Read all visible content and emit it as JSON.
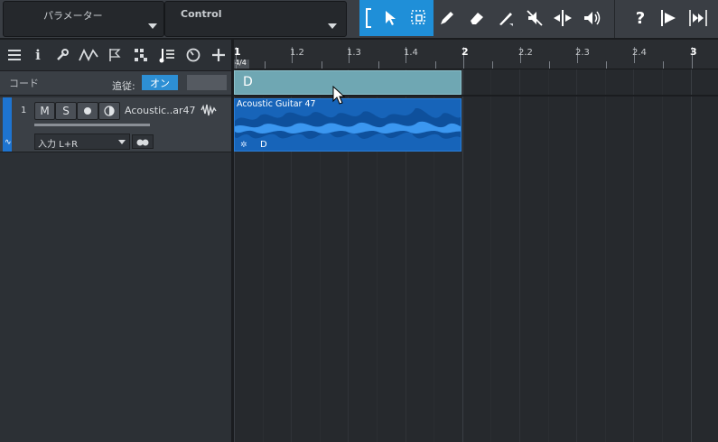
{
  "topbar": {
    "parameter_label": "パラメーター",
    "control_label": "Control",
    "tools": [
      "bracket-icon",
      "arrow-tool-icon",
      "range-tool-icon",
      "pencil-tool-icon",
      "eraser-tool-icon",
      "paint-tool-icon",
      "mute-tool-icon",
      "split-tool-icon",
      "listen-tool-icon",
      "help-icon",
      "snap-icon",
      "quantize-icon"
    ],
    "accent": "#1f8fd8"
  },
  "left_toolbar": {
    "icons": [
      "list-icon",
      "info-icon",
      "wrench-icon",
      "automation-icon",
      "marker-flag-icon",
      "grid-icon",
      "score-icon",
      "clock-icon",
      "add-icon"
    ]
  },
  "chord_track": {
    "label": "コード",
    "follow_label": "追従:",
    "follow_value": "オン"
  },
  "track": {
    "number": "1",
    "mute": "M",
    "solo": "S",
    "name": "Acoustic..ar47",
    "input": "入力 L+R"
  },
  "ruler": {
    "time_signature": "4/4",
    "marks": [
      "1",
      "1.2",
      "1.3",
      "1.4",
      "2",
      "2.2",
      "2.3",
      "2.4",
      "3"
    ]
  },
  "clips": {
    "chord_clip": "D",
    "audio_clip_title": "Acoustic Guitar 47",
    "audio_clip_chord": "D"
  }
}
